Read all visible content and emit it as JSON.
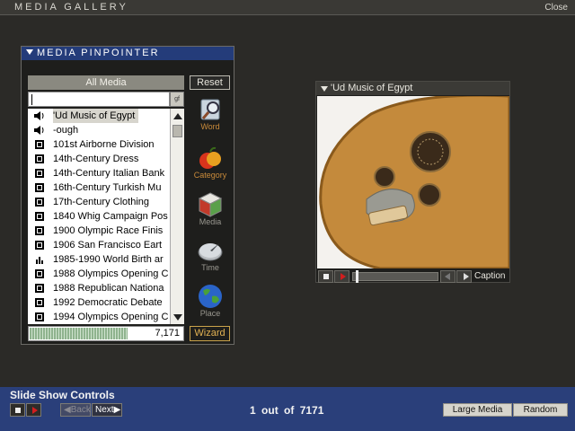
{
  "app": {
    "title": "MEDIA GALLERY",
    "close_label": "Close"
  },
  "pinpointer": {
    "title": "MEDIA PINPOINTER",
    "filter_label": "All Media",
    "reset_label": "Reset",
    "search": {
      "value": "",
      "go_label": "gf"
    },
    "items": [
      {
        "label": "'Ud Music of Egypt",
        "icon": "speaker-icon",
        "selected": true
      },
      {
        "label": "-ough",
        "icon": "speaker-icon"
      },
      {
        "label": "101st Airborne Division",
        "icon": "video-icon"
      },
      {
        "label": "14th-Century Dress",
        "icon": "video-icon"
      },
      {
        "label": "14th-Century Italian Bank",
        "icon": "video-icon"
      },
      {
        "label": "16th-Century Turkish Mu",
        "icon": "video-icon"
      },
      {
        "label": "17th-Century Clothing",
        "icon": "video-icon"
      },
      {
        "label": "1840 Whig Campaign Pos",
        "icon": "video-icon"
      },
      {
        "label": "1900 Olympic Race Finis",
        "icon": "video-icon"
      },
      {
        "label": "1906 San Francisco Eart",
        "icon": "video-icon"
      },
      {
        "label": "1985-1990 World Birth ar",
        "icon": "chart-icon"
      },
      {
        "label": "1988 Olympics Opening C",
        "icon": "video-icon"
      },
      {
        "label": "1988 Republican Nationa",
        "icon": "video-icon"
      },
      {
        "label": "1992 Democratic Debate",
        "icon": "video-icon"
      },
      {
        "label": "1994 Olympics Opening C",
        "icon": "video-icon"
      }
    ],
    "count": "7,171",
    "count_fraction": 0.85,
    "wizard_label": "Wizard",
    "tools": [
      {
        "label": "Word",
        "icon": "dictionary-icon"
      },
      {
        "label": "Category",
        "icon": "apple-icon"
      },
      {
        "label": "Media",
        "icon": "media-cube-icon"
      },
      {
        "label": "Time",
        "icon": "sundial-icon"
      },
      {
        "label": "Place",
        "icon": "globe-icon"
      }
    ]
  },
  "viewer": {
    "title": "'Ud Music of Egypt",
    "caption_label": "Caption",
    "image_subject": "oud-instrument-image",
    "progress": 0.02
  },
  "slideshow": {
    "title": "Slide Show Controls",
    "back_label": "Back",
    "next_label": "Next",
    "current": "1",
    "out_of": "out of",
    "total": "7171",
    "large_media_label": "Large Media",
    "random_label": "Random"
  },
  "colors": {
    "header_blue": "#243c7a",
    "slideshow_blue": "#2a3f7a",
    "background": "#2b2a27",
    "accent_orange": "#e2b253",
    "play_red": "#d21e1e"
  }
}
